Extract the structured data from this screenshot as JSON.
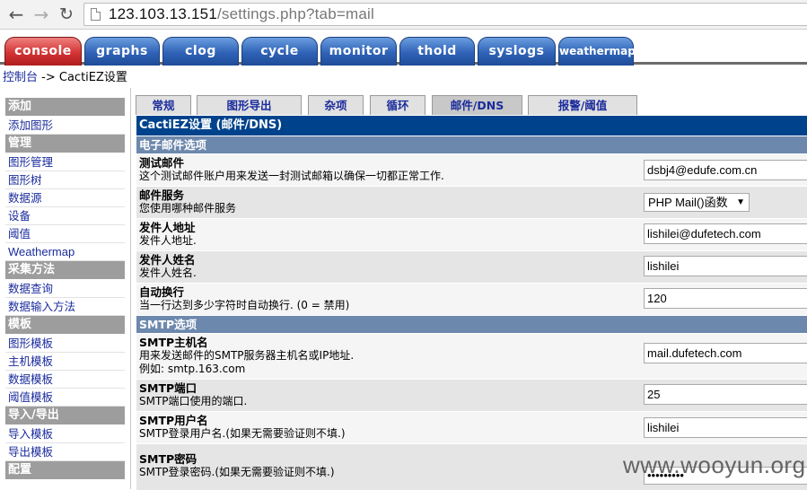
{
  "browser": {
    "url_host": "123.103.13.151",
    "url_rest": "/settings.php?tab=mail",
    "back_icon": "arrow-left-icon",
    "forward_icon": "arrow-right-icon",
    "reload_icon": "reload-icon"
  },
  "main_tabs": [
    "console",
    "graphs",
    "clog",
    "cycle",
    "monitor",
    "thold",
    "syslogs",
    "weathermap"
  ],
  "breadcrumb": {
    "home": "控制台",
    "separator": " -> ",
    "current": "CactiEZ设置"
  },
  "sidebar": [
    {
      "type": "header",
      "label": "添加"
    },
    {
      "type": "item",
      "label": "添加图形"
    },
    {
      "type": "header",
      "label": "管理"
    },
    {
      "type": "item",
      "label": "图形管理"
    },
    {
      "type": "item",
      "label": "图形树"
    },
    {
      "type": "item",
      "label": "数据源"
    },
    {
      "type": "item",
      "label": "设备"
    },
    {
      "type": "item",
      "label": "阈值"
    },
    {
      "type": "item",
      "label": "Weathermap"
    },
    {
      "type": "header",
      "label": "采集方法"
    },
    {
      "type": "item",
      "label": "数据查询"
    },
    {
      "type": "item",
      "label": "数据输入方法"
    },
    {
      "type": "header",
      "label": "模板"
    },
    {
      "type": "item",
      "label": "图形模板"
    },
    {
      "type": "item",
      "label": "主机模板"
    },
    {
      "type": "item",
      "label": "数据模板"
    },
    {
      "type": "item",
      "label": "阈值模板"
    },
    {
      "type": "header",
      "label": "导入/导出"
    },
    {
      "type": "item",
      "label": "导入模板"
    },
    {
      "type": "item",
      "label": "导出模板"
    },
    {
      "type": "header",
      "label": "配置"
    }
  ],
  "settings_tabs": [
    "常规",
    "图形导出",
    "杂项",
    "循环",
    "邮件/DNS",
    "报警/阈值"
  ],
  "settings_active_tab": "邮件/DNS",
  "panel_title": "CactiEZ设置 (邮件/DNS)",
  "sections": {
    "email": "电子邮件选项",
    "smtp": "SMTP选项"
  },
  "fields": {
    "test_email": {
      "label": "测试邮件",
      "desc": "这个测试邮件账户用来发送一封测试邮箱以确保一切都正常工作.",
      "value": "dsbj4@edufe.com.cn"
    },
    "mail_service": {
      "label": "邮件服务",
      "desc": "您使用哪种邮件服务",
      "value": "PHP Mail()函数"
    },
    "from_address": {
      "label": "发件人地址",
      "desc": "发件人地址.",
      "value": "lishilei@dufetech.com"
    },
    "from_name": {
      "label": "发件人姓名",
      "desc": "发件人姓名.",
      "value": "lishilei"
    },
    "word_wrap": {
      "label": "自动换行",
      "desc": "当一行达到多少字符时自动换行. (0 = 禁用)",
      "value": "120"
    },
    "smtp_host": {
      "label": "SMTP主机名",
      "desc": "用来发送邮件的SMTP服务器主机名或IP地址.",
      "desc2": "例如: smtp.163.com",
      "value": "mail.dufetech.com"
    },
    "smtp_port": {
      "label": "SMTP端口",
      "desc": "SMTP端口使用的端口.",
      "value": "25"
    },
    "smtp_user": {
      "label": "SMTP用户名",
      "desc": "SMTP登录用户名.(如果无需要验证则不填.)",
      "value": "lishilei"
    },
    "smtp_pass": {
      "label": "SMTP密码",
      "desc": "SMTP登录密码.(如果无需要验证则不填.)",
      "value": "•••••••••"
    }
  },
  "watermark": "www.wooyun.org"
}
